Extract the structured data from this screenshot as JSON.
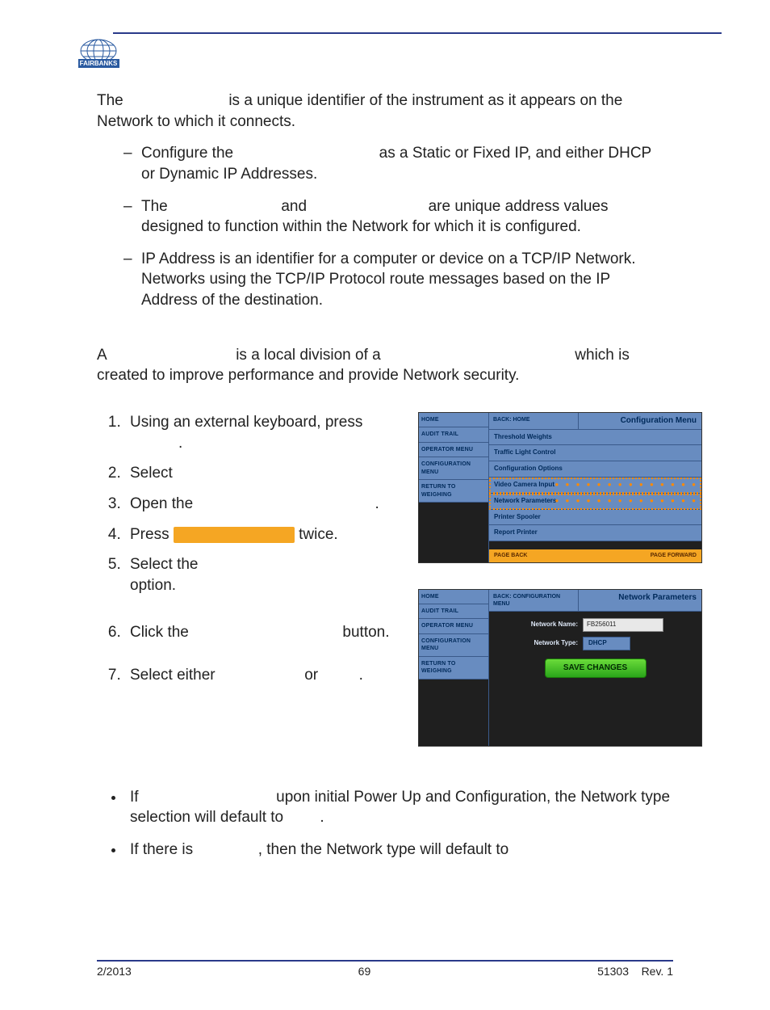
{
  "header": {
    "brand": "FAIRBANKS"
  },
  "body": {
    "p1_a": "The",
    "p1_b": "is a unique identifier of the instrument as it appears on the Network to which it connects.",
    "dash1_a": "Configure the",
    "dash1_b": "as a Static or Fixed IP, and either DHCP or Dynamic IP Addresses.",
    "dash2_a": "The",
    "dash2_b": "and",
    "dash2_c": "are unique address values designed to function within the Network for which it is configured.",
    "dash3": "IP Address is an identifier for a computer or device on a TCP/IP Network. Networks using the TCP/IP Protocol route messages based on the IP Address of the destination.",
    "p2_a": "A",
    "p2_b": "is a local division of a",
    "p2_c": "which is created to improve performance and provide Network security.",
    "steps": {
      "s1_a": "Using an external keyboard, press",
      "s1_b": ".",
      "s2": "Select",
      "s3_a": "Open the",
      "s3_b": ".",
      "s4_a": "Press",
      "s4_b": "twice.",
      "s5_a": "Select the",
      "s5_b": "option.",
      "s6_a": "Click the",
      "s6_b": "button.",
      "s7_a": "Select either",
      "s7_b": "or",
      "s7_c": "."
    },
    "bullets": {
      "b1_a": "If",
      "b1_b": "upon initial Power Up and Configuration, the Network type selection will default to",
      "b1_c": ".",
      "b2_a": "If there is",
      "b2_b": ", then the Network type will default to"
    }
  },
  "shot1": {
    "sidebar": [
      "HOME",
      "AUDIT TRAIL",
      "OPERATOR MENU",
      "CONFIGURATION MENU",
      "RETURN TO WEIGHING"
    ],
    "back": "BACK: HOME",
    "title": "Configuration Menu",
    "items": [
      "Threshold Weights",
      "Traffic Light Control",
      "Configuration Options",
      "Video Camera Input",
      "Network Parameters",
      "Printer Spooler",
      "Report Printer"
    ],
    "page_back": "PAGE BACK",
    "page_forward": "PAGE FORWARD"
  },
  "shot2": {
    "sidebar": [
      "HOME",
      "AUDIT TRAIL",
      "OPERATOR MENU",
      "CONFIGURATION MENU",
      "RETURN TO WEIGHING"
    ],
    "back": "BACK: CONFIGURATION MENU",
    "title": "Network Parameters",
    "name_label": "Network Name:",
    "name_value": "FB256011",
    "type_label": "Network Type:",
    "type_value": "DHCP",
    "save": "SAVE CHANGES"
  },
  "footer": {
    "date": "2/2013",
    "page": "69",
    "doc": "51303",
    "rev": "Rev. 1"
  }
}
